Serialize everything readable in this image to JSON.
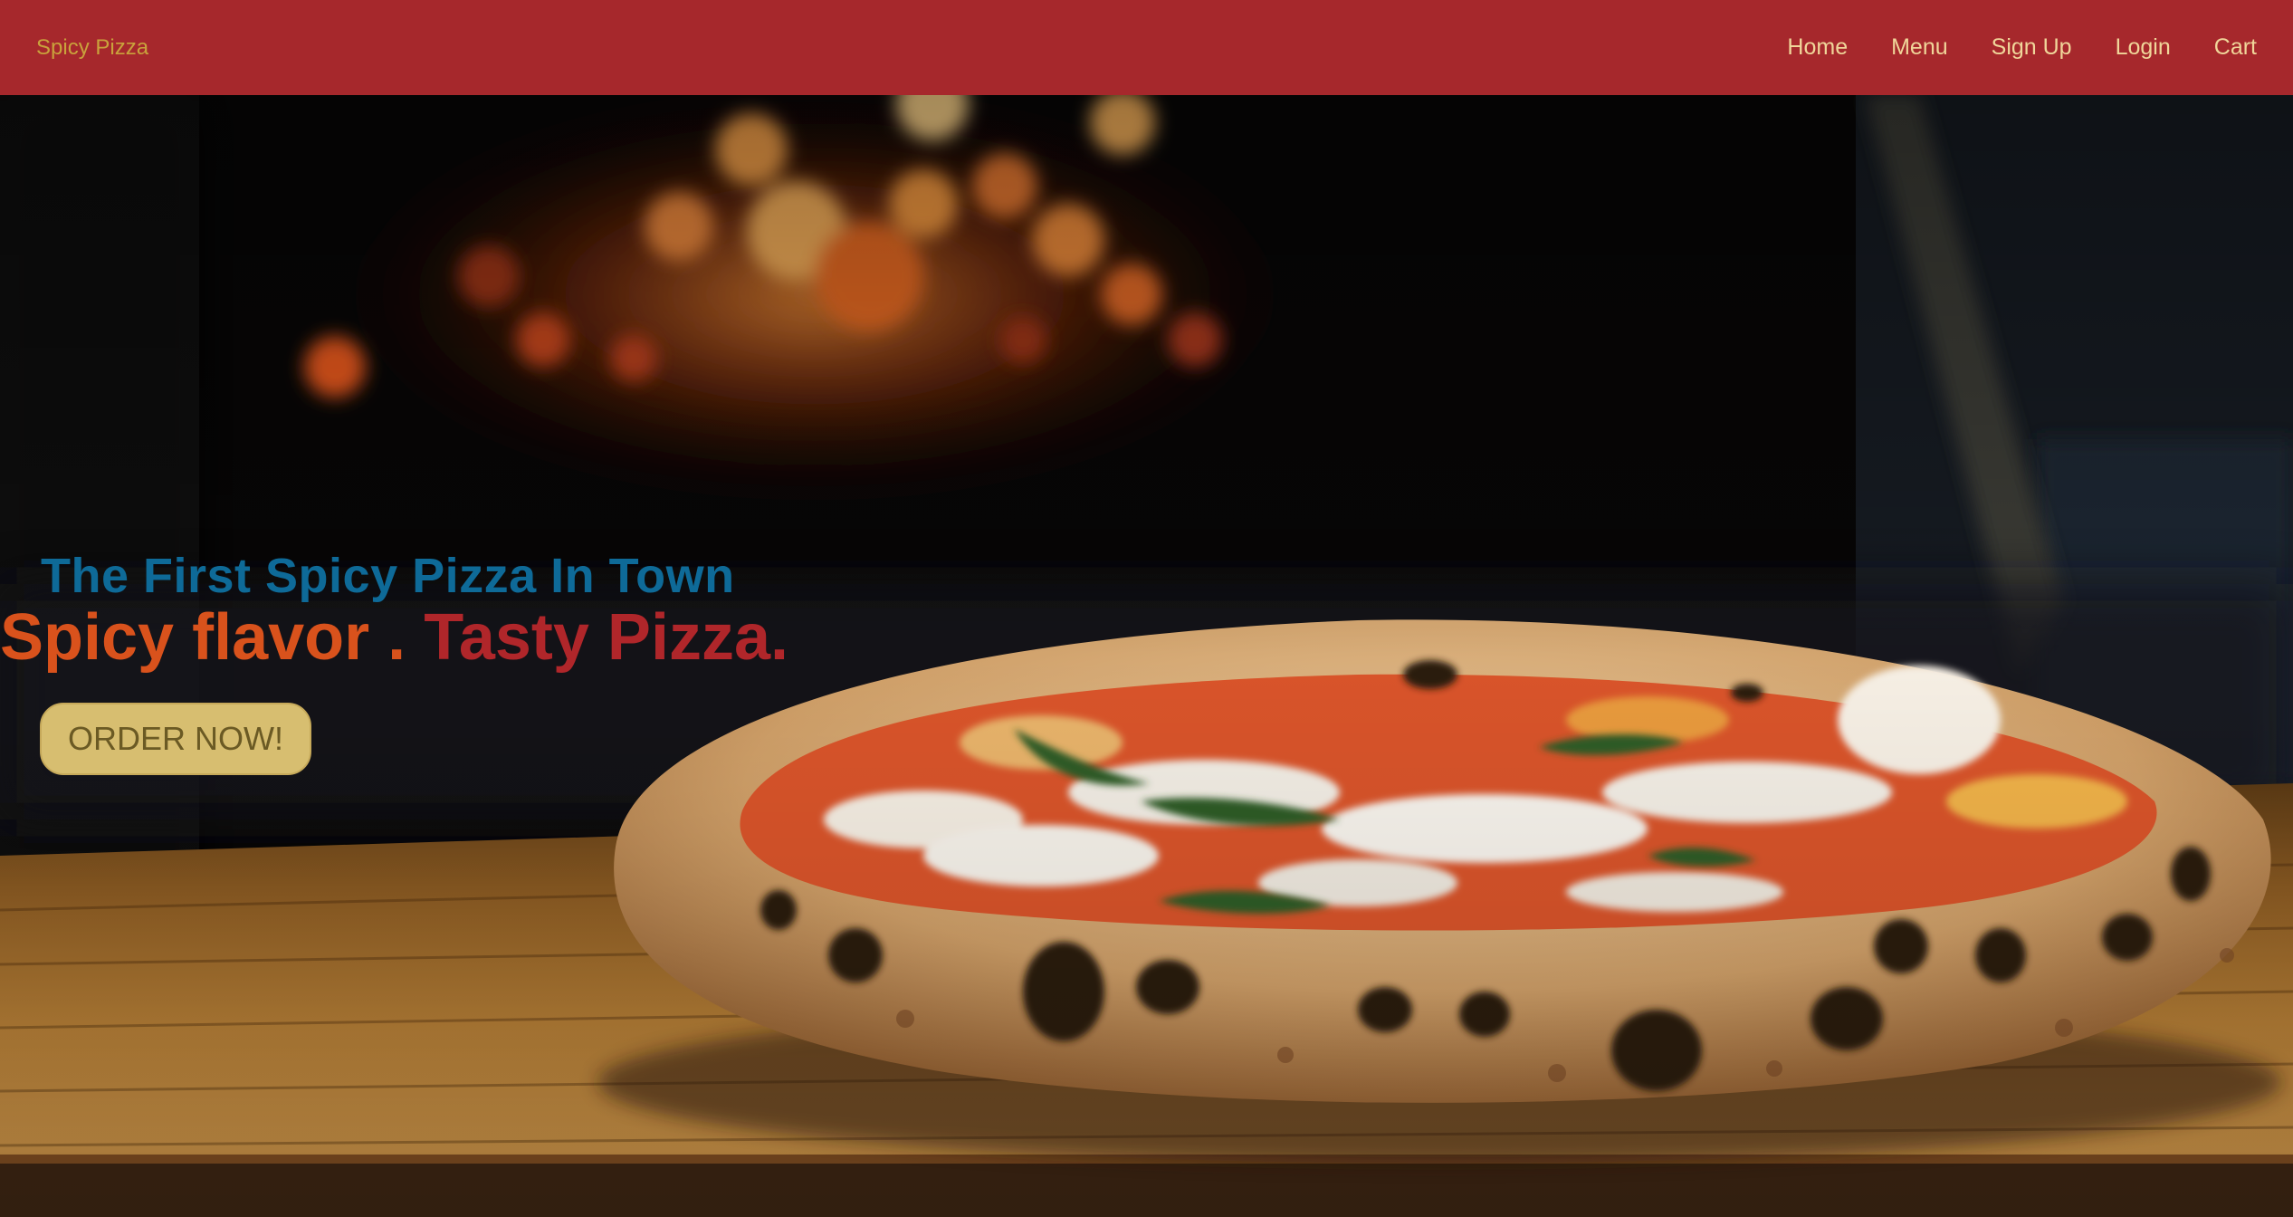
{
  "navbar": {
    "brand": "Spicy Pizza",
    "links": [
      {
        "label": "Home"
      },
      {
        "label": "Menu"
      },
      {
        "label": "Sign Up"
      },
      {
        "label": "Login"
      },
      {
        "label": "Cart"
      }
    ]
  },
  "hero": {
    "tagline": "The First Spicy Pizza In Town",
    "headline_part1": "Spicy flavor . ",
    "headline_part2": "Tasty Pizza.",
    "cta_label": "ORDER NOW!"
  },
  "colors": {
    "navbar_bg": "#a6282c",
    "brand_text": "#c9a23c",
    "nav_link_text": "#f0d69a",
    "tagline": "#0e6a98",
    "headline_orange": "#d9521c",
    "headline_red": "#b0262a",
    "cta_bg": "#d7be70",
    "cta_text": "#6b5a24"
  }
}
